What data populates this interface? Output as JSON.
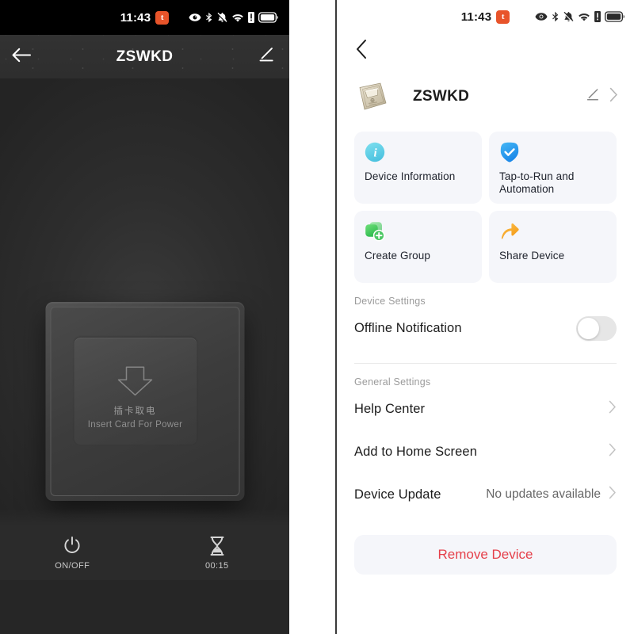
{
  "status_bar": {
    "time": "11:43",
    "app_badge_letter": "t",
    "icons": [
      "eye-icon",
      "bluetooth-icon",
      "bell-muted-icon",
      "wifi-icon",
      "sim-alert-icon",
      "battery-icon"
    ]
  },
  "left_panel": {
    "app_bar": {
      "back_icon": "arrow-left-icon",
      "title": "ZSWKD",
      "edit_icon": "pencil-icon"
    },
    "device_image": {
      "arrow_icon": "arrow-down-outline-icon",
      "label_cn": "插卡取电",
      "label_en": "Insert Card For Power"
    },
    "bottom_bar": [
      {
        "icon": "power-icon",
        "label": "ON/OFF"
      },
      {
        "icon": "hourglass-icon",
        "label": "00:15"
      }
    ]
  },
  "right_panel": {
    "back_icon": "chevron-left-icon",
    "device": {
      "thumbnail": "card-switch-thumbnail",
      "name": "ZSWKD",
      "edit_icon": "pencil-icon",
      "chevron_icon": "chevron-right-icon"
    },
    "tiles": [
      {
        "label": "Device Information",
        "icon": "info-circle-icon",
        "color": "#5ecfe6"
      },
      {
        "label": "Tap-to-Run and Automation",
        "icon": "check-shield-icon",
        "color": "#2196f3"
      },
      {
        "label": "Create Group",
        "icon": "create-group-icon",
        "color": "#4cc764"
      },
      {
        "label": "Share Device",
        "icon": "share-arrow-icon",
        "color": "#f5a623"
      }
    ],
    "device_settings": {
      "header": "Device Settings",
      "offline_notification": {
        "label": "Offline Notification",
        "enabled": false
      }
    },
    "general_settings": {
      "header": "General Settings",
      "rows": [
        {
          "label": "Help Center",
          "value": ""
        },
        {
          "label": "Add to Home Screen",
          "value": ""
        },
        {
          "label": "Device Update",
          "value": "No updates available"
        }
      ]
    },
    "remove_button": {
      "label": "Remove Device",
      "color": "#e5404a"
    }
  }
}
